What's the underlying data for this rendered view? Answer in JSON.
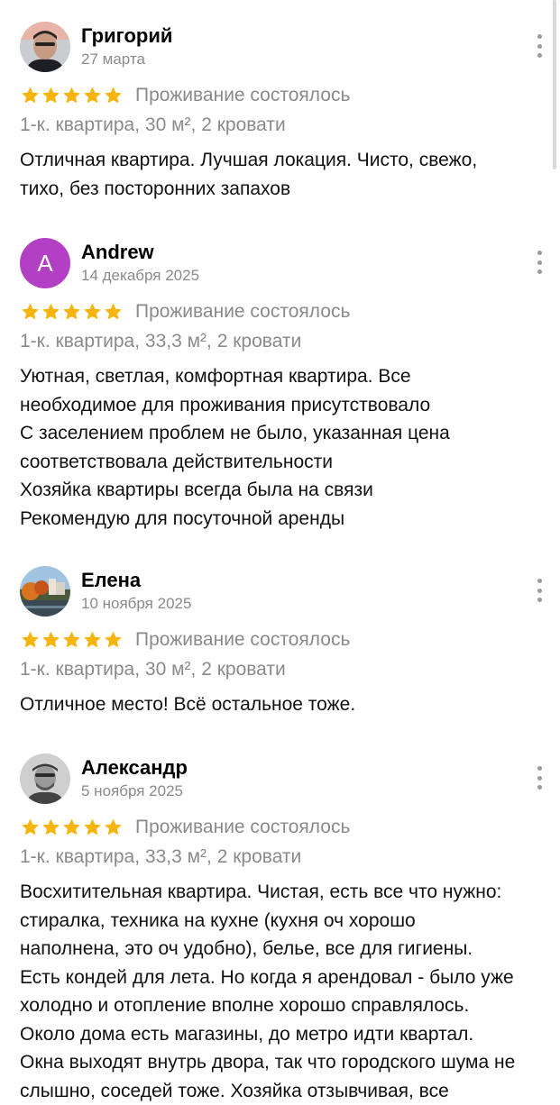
{
  "colors": {
    "star": "#f7b40c",
    "muted": "#8a8a8a",
    "avatar_andrew": "#b340c4"
  },
  "reviews": [
    {
      "name": "Григорий",
      "date": "27 марта",
      "avatar": "photo",
      "stars": 5,
      "status": "Проживание состоялось",
      "apartment": "1-к. квартира, 30 м², 2 кровати",
      "lines": [
        "Отличная квартира. Лучшая локация. Чисто, свежо,",
        "тихо, без посторонних запахов"
      ]
    },
    {
      "name": "Andrew",
      "date": "14 декабря 2025",
      "avatar_letter": "A",
      "stars": 5,
      "status": "Проживание состоялось",
      "apartment": "1-к. квартира, 33,3 м², 2 кровати",
      "lines": [
        "Уютная, светлая, комфортная квартира. Все",
        "необходимое для проживания присутствовало",
        "С заселением проблем не было, указанная цена",
        "соответствовала действительности",
        "Хозяйка квартиры всегда была на связи",
        "Рекомендую для посуточной аренды"
      ]
    },
    {
      "name": "Елена",
      "date": "10 ноября 2025",
      "avatar": "photo",
      "stars": 5,
      "status": "Проживание состоялось",
      "apartment": "1-к. квартира, 30 м², 2 кровати",
      "lines": [
        "Отличное место! Всё остальное тоже."
      ]
    },
    {
      "name": "Александр",
      "date": "5 ноября 2025",
      "avatar": "photo",
      "stars": 5,
      "status": "Проживание состоялось",
      "apartment": "1-к. квартира, 33,3 м², 2 кровати",
      "lines": [
        "Восхитительная квартира. Чистая, есть все что нужно:",
        "стиралка, техника на кухне (кухня оч хорошо",
        "наполнена, это оч удобно), белье, все для гигиены.",
        "Есть кондей для лета. Но когда я арендовал - было уже",
        "холодно и отопление вполне хорошо справлялось.",
        "Около дома есть магазины, до метро идти квартал.",
        "Окна выходят внутрь двора, так что городского шума не",
        "слышно, соседей тоже. Хозяйка отзывчивая, все"
      ]
    }
  ]
}
